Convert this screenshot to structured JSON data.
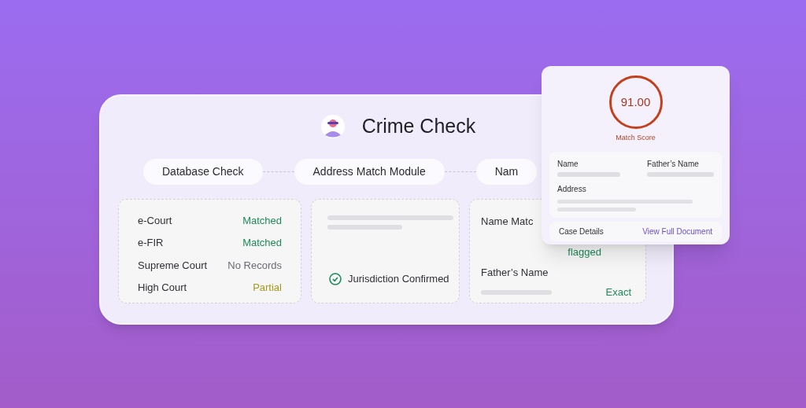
{
  "card": {
    "title": "Crime Check",
    "steps": [
      {
        "label": "Database Check"
      },
      {
        "label": "Address Match Module"
      },
      {
        "label": "Nam"
      }
    ],
    "database": [
      {
        "source": "e-Court",
        "result": "Matched",
        "kind": "match"
      },
      {
        "source": "e-FIR",
        "result": "Matched",
        "kind": "match"
      },
      {
        "source": "Supreme Court",
        "result": "No Records",
        "kind": "none"
      },
      {
        "source": "High Court",
        "result": "Partial",
        "kind": "partial"
      }
    ],
    "address": {
      "status": "Jurisdiction Confirmed"
    },
    "name_match": {
      "name_label": "Name Matc",
      "name_result": "flagged",
      "father_label": "Father’s Name",
      "father_result": "Exact"
    }
  },
  "popup": {
    "score": "91.00",
    "score_label": "Match Score",
    "fields": [
      {
        "label": "Name"
      },
      {
        "label": "Father’s Name"
      }
    ],
    "address_label": "Address",
    "case_label": "Case Details",
    "link": "View Full Document"
  }
}
